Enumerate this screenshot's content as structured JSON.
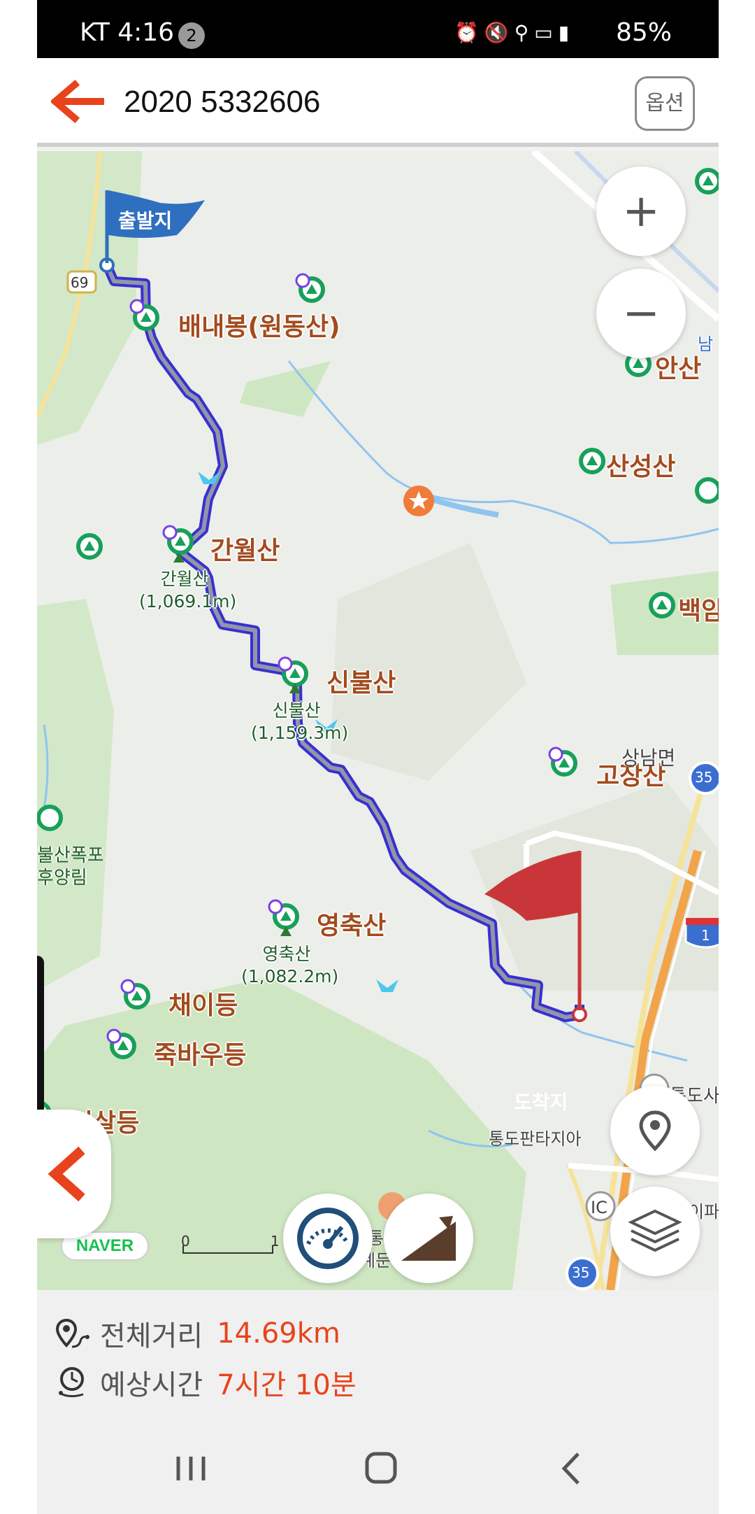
{
  "status_bar": {
    "carrier_time": "KT 4:16",
    "notification_count": "2",
    "icons": [
      "alarm-icon",
      "mute-icon",
      "location-icon",
      "hd-icon",
      "5g-icon",
      "signal-icon"
    ],
    "battery": "85%"
  },
  "header": {
    "title": "2020 5332606",
    "option_label": "옵션"
  },
  "map": {
    "start_flag": "출발지",
    "end_flag": "도착지",
    "road_badge_69": "69",
    "road_badge_35a": "35",
    "road_badge_35b": "35",
    "highway_badge": "1",
    "peaks": [
      {
        "name": "배내봉(원동산)"
      },
      {
        "name": "간월산"
      },
      {
        "name": "신불산"
      },
      {
        "name": "영축산"
      },
      {
        "name": "안산"
      },
      {
        "name": "산성산"
      },
      {
        "name": "백암"
      },
      {
        "name": "고장산"
      },
      {
        "name": "채이등"
      },
      {
        "name": "죽바우등"
      },
      {
        "name": "시살등"
      }
    ],
    "elevations": {
      "ganwol_name": "간월산",
      "ganwol_height": "(1,069.1m)",
      "sinbul_name": "신불산",
      "sinbul_height": "(1,159.3m)",
      "yeongchuk_name": "영축산",
      "yeongchuk_height": "(1,082.2m)"
    },
    "small_labels": {
      "sangbuk": "상남면",
      "tongdo": "통도사",
      "nam": "남",
      "ic": "IC",
      "tongdo_fantasia": "통도판타지아",
      "ipae": "이파",
      "waterfall_1": "불산폭포",
      "waterfall_2": "후양림",
      "tong_1": "통",
      "tong_2": "계둔"
    },
    "naver_logo": "NAVER",
    "scale_start": "0",
    "scale_end": "1"
  },
  "info": {
    "distance_label": "전체거리",
    "distance_value": "14.69km",
    "time_label": "예상시간",
    "time_value": "7시간 10분"
  },
  "colors": {
    "accent": "#e8431d",
    "route": "#3a2fd1",
    "peak_label": "#a34b1e",
    "start_flag": "#2f6fbf",
    "end_flag": "#c9363a"
  }
}
